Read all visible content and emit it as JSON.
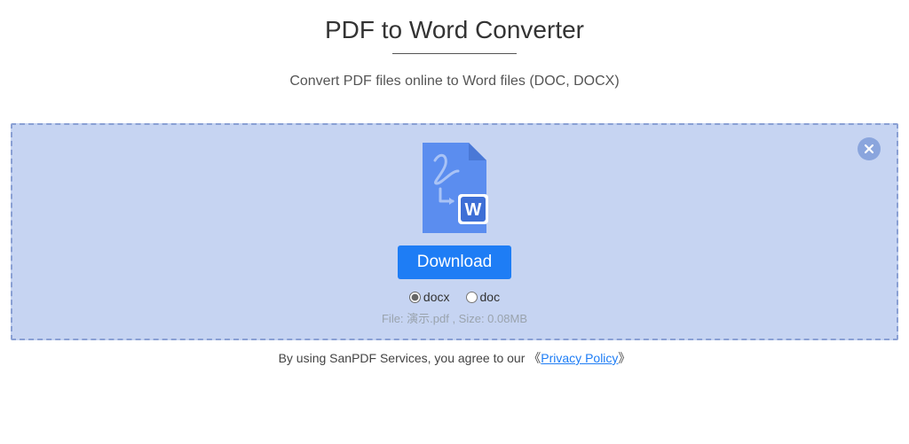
{
  "header": {
    "title": "PDF to Word Converter",
    "subtitle": "Convert PDF files online to Word files (DOC, DOCX)"
  },
  "main": {
    "download_label": "Download",
    "formats": {
      "docx": "docx",
      "doc": "doc",
      "selected": "docx"
    },
    "file_info": "File: 演示.pdf , Size: 0.08MB"
  },
  "footer": {
    "text_prefix": "By using SanPDF Services, you agree to our ",
    "bracket_open": "《",
    "link_label": "Privacy Policy",
    "bracket_close": "》"
  },
  "icons": {
    "close": "close-icon",
    "file": "pdf-to-word-icon"
  }
}
